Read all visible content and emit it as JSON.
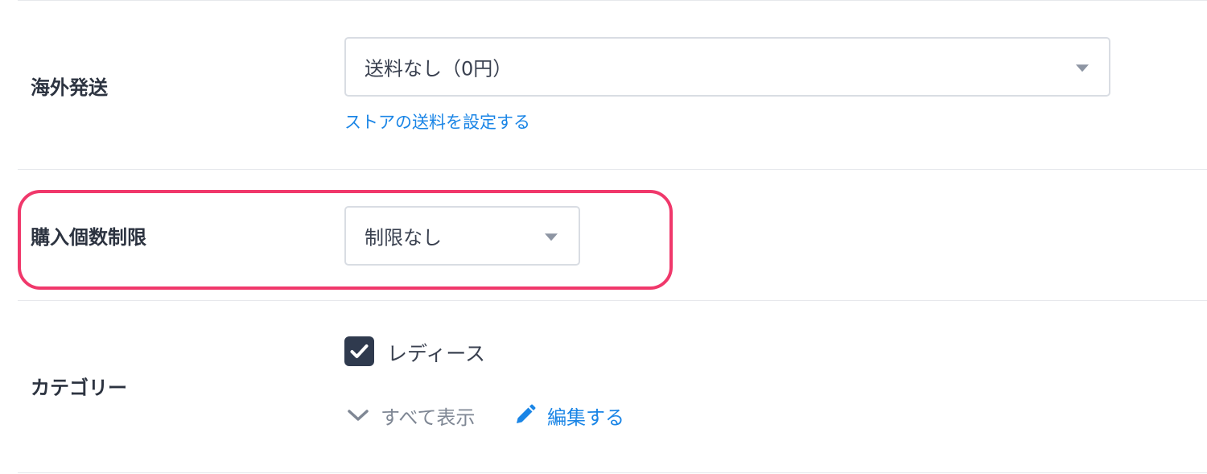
{
  "overseas_shipping": {
    "label": "海外発送",
    "select_value": "送料なし（0円）",
    "settings_link": "ストアの送料を設定する"
  },
  "purchase_limit": {
    "label": "購入個数制限",
    "select_value": "制限なし",
    "highlighted": true,
    "highlight_color": "#f0386b"
  },
  "category": {
    "label": "カテゴリー",
    "checked_item": {
      "label": "レディース",
      "checked": true
    },
    "show_all_label": "すべて表示",
    "edit_label": "編集する"
  },
  "colors": {
    "link": "#1a85e6",
    "checkbox_fill": "#2f3a4e",
    "text_primary": "#2c3340",
    "text_muted": "#7f8794"
  },
  "icons": {
    "select_caret": "caret-down-icon",
    "checkbox": "check-icon",
    "show_all": "chevron-down-icon",
    "edit": "pencil-icon"
  }
}
